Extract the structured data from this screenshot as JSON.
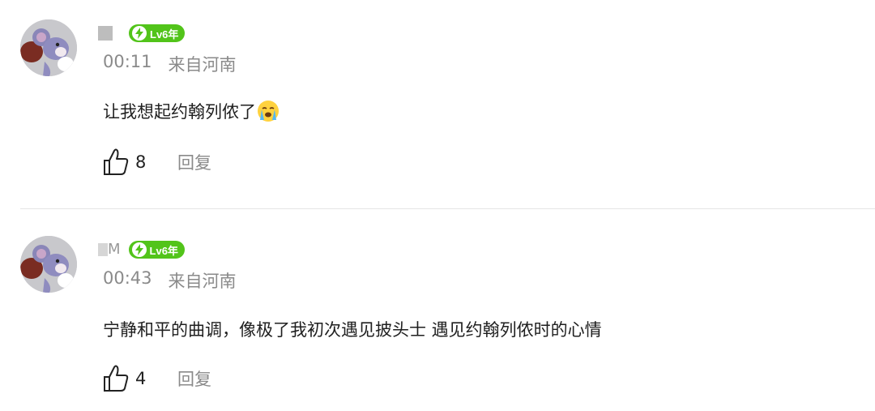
{
  "comments": [
    {
      "username": "",
      "badge": "Lv6年",
      "time": "00:11",
      "location": "来自河南",
      "text": "让我想起约翰列侬了",
      "emoji": "loudly-crying-face",
      "likes": "8",
      "reply_label": "回复"
    },
    {
      "username": "M",
      "badge": "Lv6年",
      "time": "00:43",
      "location": "来自河南",
      "text": "宁静和平的曲调，像极了我初次遇见披头士 遇见约翰列侬时的心情",
      "emoji": "",
      "likes": "4",
      "reply_label": "回复"
    }
  ],
  "colors": {
    "badge": "#52c41a",
    "meta_text": "#8a8a8a",
    "divider": "#e5e5e5"
  },
  "icons": [
    "like-icon",
    "lightning-icon",
    "avatar-mouse-icon"
  ]
}
